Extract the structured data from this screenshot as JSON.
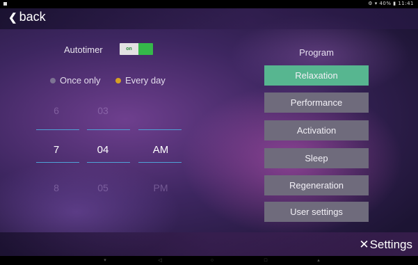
{
  "status_bar": {
    "right": "⚙ ▾ 40% ▮ 11:41"
  },
  "header": {
    "back_label": "back"
  },
  "autotimer": {
    "label": "Autotimer",
    "toggle_state": "on"
  },
  "schedule": {
    "once_label": "Once only",
    "every_label": "Every day",
    "selected": "Every day"
  },
  "time_picker": {
    "hours": {
      "prev": "6",
      "current": "7",
      "next": "8"
    },
    "minutes": {
      "prev": "03",
      "current": "04",
      "next": "05"
    },
    "ampm": {
      "prev": "",
      "current": "AM",
      "next": "PM"
    }
  },
  "program": {
    "title": "Program",
    "selected": "Relaxation",
    "items": [
      "Relaxation",
      "Performance",
      "Activation",
      "Sleep",
      "Regeneration",
      "User settings"
    ]
  },
  "footer": {
    "settings_label": "Settings"
  },
  "colors": {
    "selected_button": "#57b690",
    "button": "#6f6b7c",
    "toggle_green": "#35b84a",
    "radio_selected": "#d5a024",
    "picker_line": "#4fa3d8"
  }
}
